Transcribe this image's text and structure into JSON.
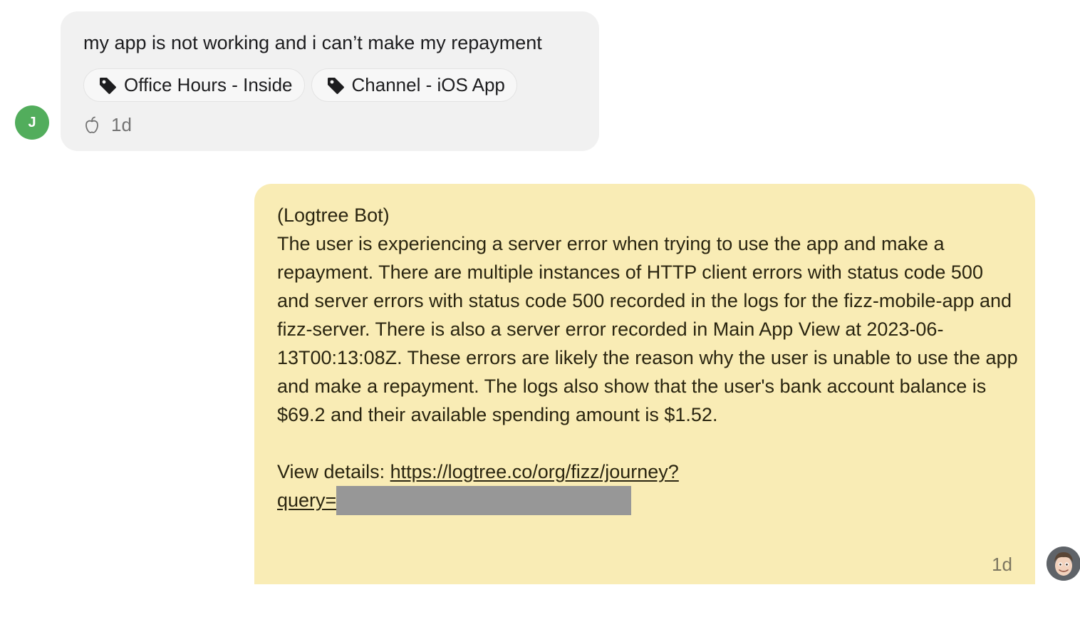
{
  "user_message": {
    "avatar_initial": "J",
    "text": "my app is not working and i can’t make my repayment",
    "tags": [
      {
        "label": "Office Hours - Inside",
        "icon": "tag-icon"
      },
      {
        "label": "Channel - iOS App",
        "icon": "tag-icon"
      }
    ],
    "channel_icon": "apple-icon",
    "time": "1d",
    "colors": {
      "bubble": "#f1f1f1",
      "avatar": "#52ad5c"
    }
  },
  "bot_note": {
    "author": "(Logtree Bot)",
    "summary": "The user is experiencing a server error when trying to use the app and make a repayment. There are multiple instances of HTTP client errors with status code 500 and server errors with status code 500 recorded in the logs for the fizz-mobile-app and fizz-server. There is also a server error recorded in Main App View at 2023-06-13T00:13:08Z. These errors are likely the reason why the user is unable to use the app and make a repayment. The logs also show that the user's bank account balance is $69.2 and their available spending amount is $1.52.",
    "details_label": "View details:",
    "details_link_line1": "https://logtree.co/org/fizz/journey?",
    "details_link_line2": "query=",
    "time": "1d",
    "colors": {
      "bubble": "#f9ecb5",
      "redaction": "#979797"
    }
  },
  "admin_avatar": {
    "icon": "memoji-avatar-icon"
  }
}
